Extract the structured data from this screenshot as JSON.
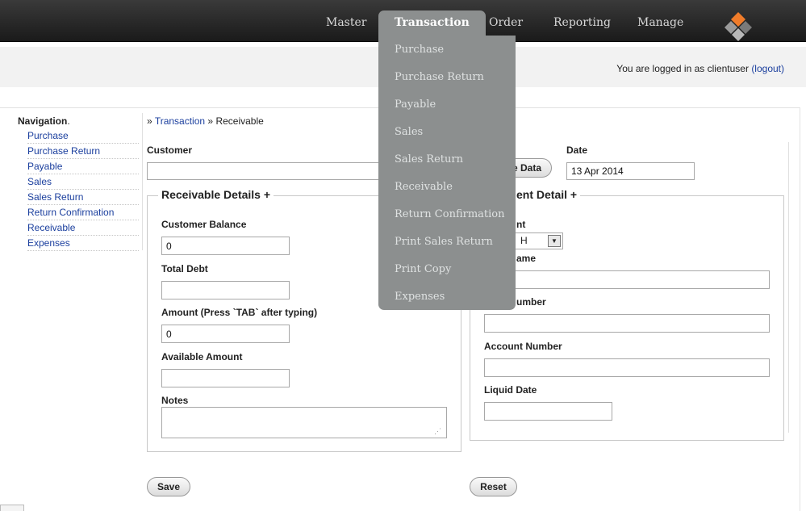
{
  "topnav": {
    "items": [
      "Master",
      "Transaction",
      "Order",
      "Reporting",
      "Manage"
    ],
    "active_index": 1
  },
  "dropdown": {
    "items": [
      "Purchase",
      "Purchase Return",
      "Payable",
      "Sales",
      "Sales Return",
      "Receivable",
      "Return Confirmation",
      "Print Sales Return",
      "Print Copy",
      "Expenses"
    ]
  },
  "header": {
    "login_prefix": "You are logged in as clientuser",
    "logout_label": "(logout)"
  },
  "sidebar": {
    "title": "Navigation",
    "title_suffix": ".",
    "items": [
      "Purchase",
      "Purchase Return",
      "Payable",
      "Sales",
      "Sales Return",
      "Return Confirmation",
      "Receivable",
      "Expenses"
    ]
  },
  "breadcrumb": {
    "sep": "»",
    "parent": "Transaction",
    "current": "Receivable"
  },
  "form": {
    "customer_label": "Customer",
    "customer_value": "",
    "data_button_partial": "e Data",
    "date_label": "Date",
    "date_value": "13 Apr 2014",
    "receivable_legend": "Receivable Details +",
    "customer_balance_label": "Customer Balance",
    "customer_balance_value": "0",
    "total_debt_label": "Total Debt",
    "total_debt_value": "",
    "amount_label": "Amount (Press `TAB` after typing)",
    "amount_value": "0",
    "available_amount_label": "Available Amount",
    "available_amount_value": "",
    "notes_label": "Notes",
    "notes_value": "",
    "payment_legend_partial": "ent Detail +",
    "payment_type_label_partial": "nt",
    "payment_type_value_partial": "H",
    "name_label_partial": "ame",
    "name_value": "",
    "number_label_partial": "umber",
    "number_value": "",
    "account_number_label": "Account Number",
    "account_number_value": "",
    "liquid_date_label": "Liquid Date",
    "liquid_date_value": "",
    "save_label": "Save",
    "reset_label": "Reset"
  },
  "colors": {
    "link": "#1b3f9e",
    "dropdown_bg": "#8c8f8f",
    "logo_orange": "#f07c2a"
  }
}
